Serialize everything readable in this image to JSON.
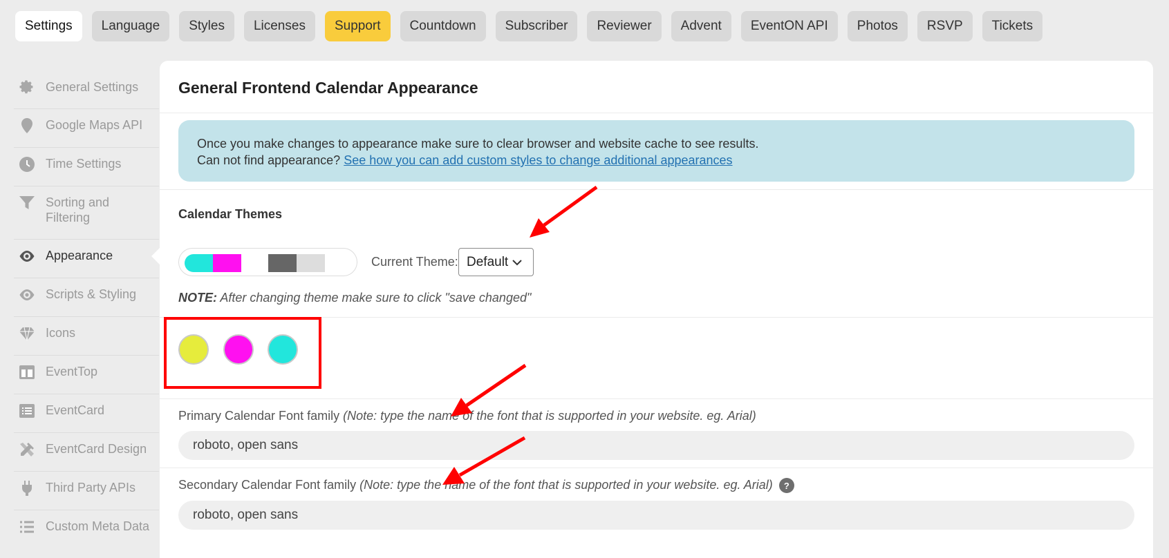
{
  "tabs": [
    {
      "label": "Settings",
      "state": "active"
    },
    {
      "label": "Language",
      "state": ""
    },
    {
      "label": "Styles",
      "state": ""
    },
    {
      "label": "Licenses",
      "state": ""
    },
    {
      "label": "Support",
      "state": "support"
    },
    {
      "label": "Countdown",
      "state": ""
    },
    {
      "label": "Subscriber",
      "state": ""
    },
    {
      "label": "Reviewer",
      "state": ""
    },
    {
      "label": "Advent",
      "state": ""
    },
    {
      "label": "EventON API",
      "state": ""
    },
    {
      "label": "Photos",
      "state": ""
    },
    {
      "label": "RSVP",
      "state": ""
    },
    {
      "label": "Tickets",
      "state": ""
    }
  ],
  "sidebar": {
    "items": [
      {
        "label": "General Settings",
        "icon": "gear-icon"
      },
      {
        "label": "Google Maps API",
        "icon": "map-pin-icon"
      },
      {
        "label": "Time Settings",
        "icon": "clock-icon"
      },
      {
        "label": "Sorting and Filtering",
        "icon": "filter-icon"
      },
      {
        "label": "Appearance",
        "icon": "eye-icon",
        "active": true
      },
      {
        "label": "Scripts & Styling",
        "icon": "eye-icon"
      },
      {
        "label": "Icons",
        "icon": "diamond-icon"
      },
      {
        "label": "EventTop",
        "icon": "layout-icon"
      },
      {
        "label": "EventCard",
        "icon": "list-card-icon"
      },
      {
        "label": "EventCard Design",
        "icon": "pencil-ruler-icon"
      },
      {
        "label": "Third Party APIs",
        "icon": "plug-icon"
      },
      {
        "label": "Custom Meta Data",
        "icon": "list-icon"
      }
    ]
  },
  "panel": {
    "title": "General Frontend Calendar Appearance",
    "notice": {
      "line1": "Once you make changes to appearance make sure to clear browser and website cache to see results.",
      "line2_prefix": "Can not find appearance?",
      "line2_link": "See how you can add custom styles to change additional appearances"
    },
    "themes": {
      "label": "Calendar Themes",
      "current_label": "Current Theme:",
      "current_value": "Default",
      "swatches": [
        "#22e6dc",
        "#ff10f0",
        "#666666",
        "#dddddd"
      ],
      "note_bold": "NOTE:",
      "note_text": "After changing theme make sure to click \"save changed\""
    },
    "colors": [
      "#e6ec3c",
      "#ff10f0",
      "#22e6dc"
    ],
    "primary_font": {
      "label": "Primary Calendar Font family",
      "note": "(Note: type the name of the font that is supported in your website. eg. Arial)",
      "value": "roboto, open sans"
    },
    "secondary_font": {
      "label": "Secondary Calendar Font family",
      "note": "(Note: type the name of the font that is supported in your website. eg. Arial)",
      "value": "roboto, open sans",
      "help": "?"
    }
  },
  "annotations": {
    "color": "#ff0000"
  }
}
